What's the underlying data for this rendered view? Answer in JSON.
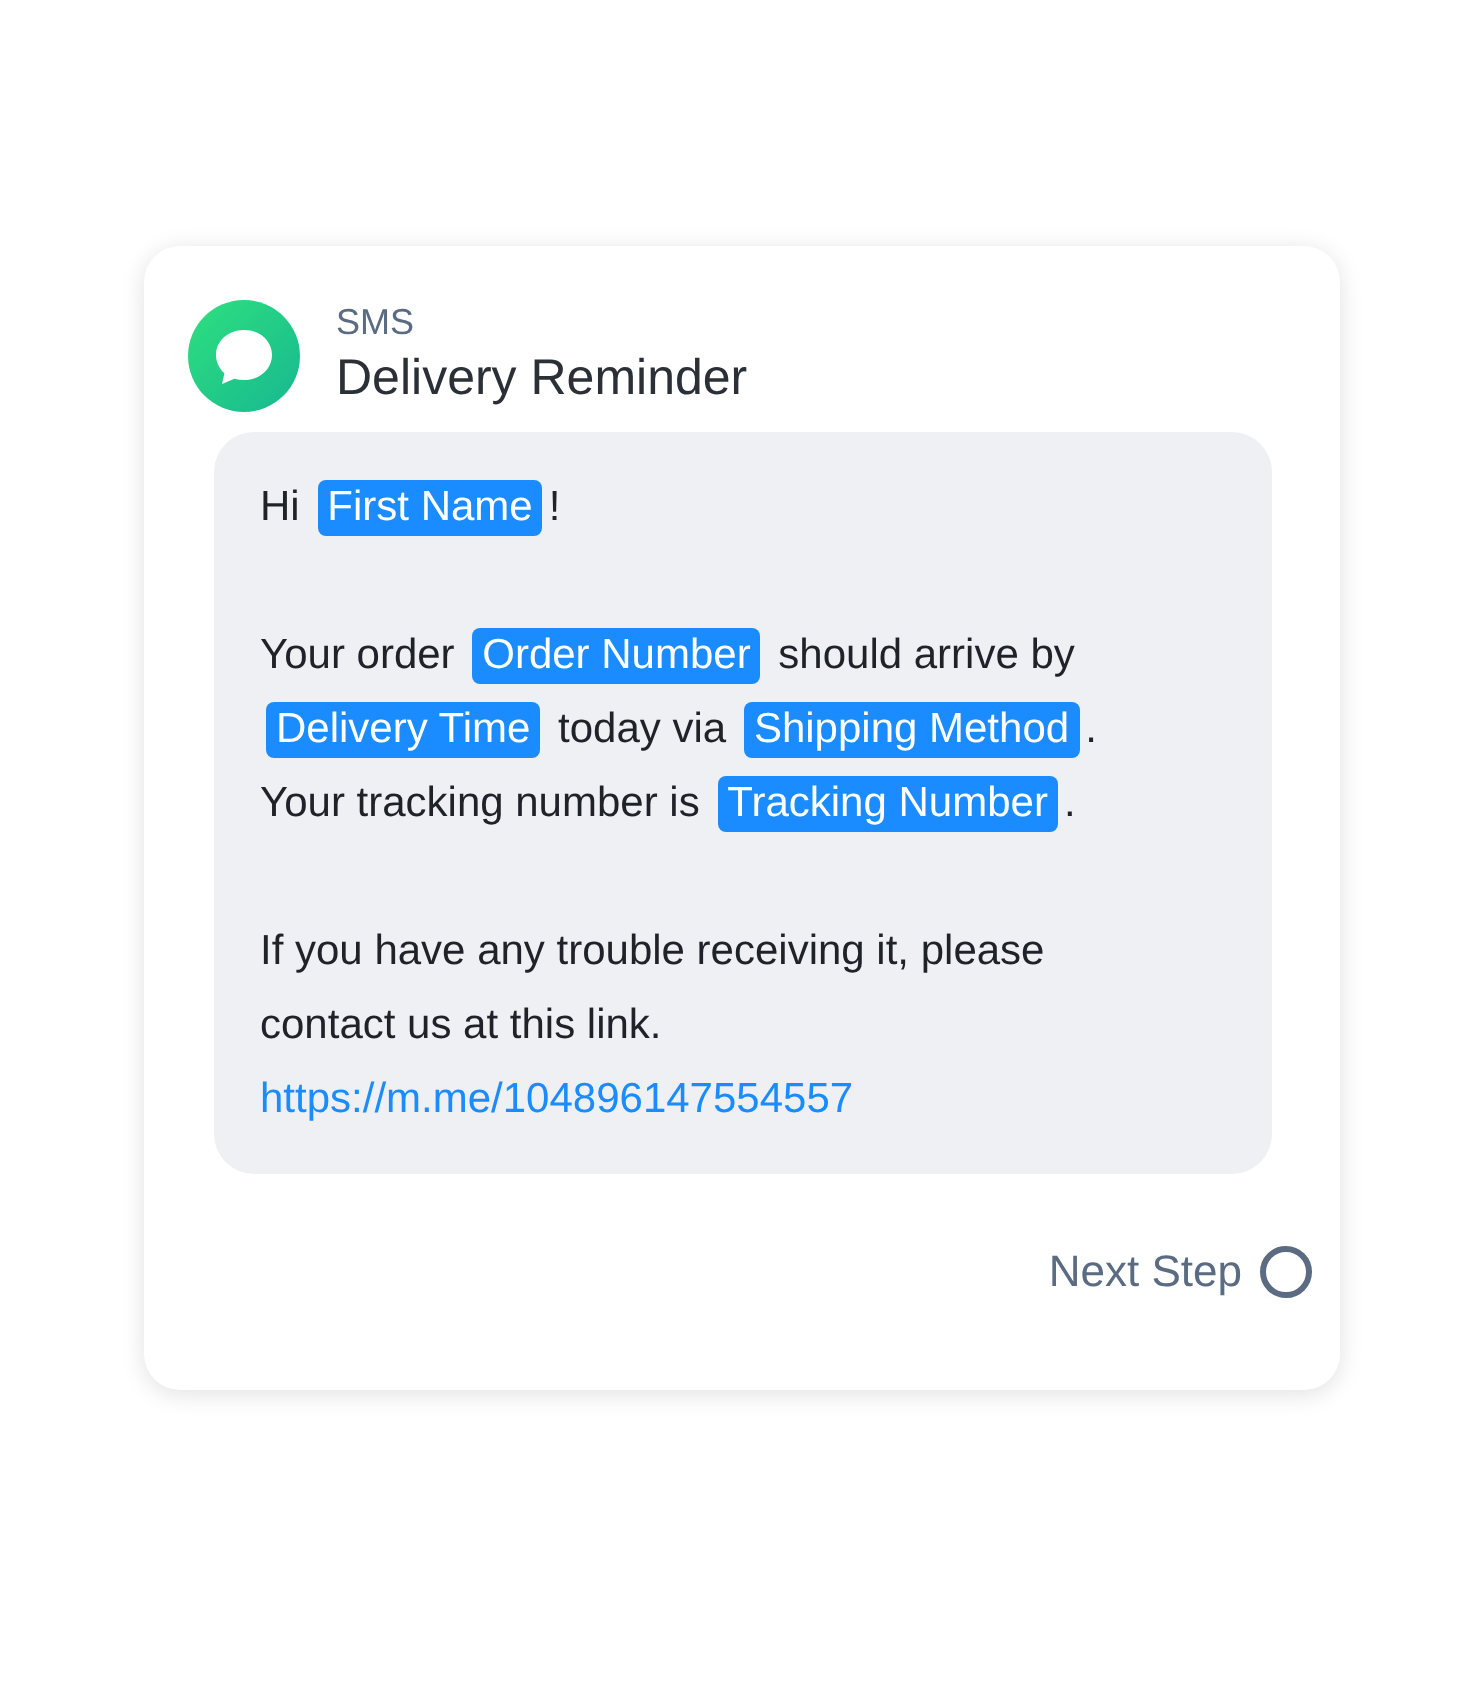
{
  "header": {
    "channel": "SMS",
    "title": "Delivery Reminder"
  },
  "message": {
    "paragraphs": [
      {
        "lines": [
          [
            {
              "kind": "text",
              "text": "Hi "
            },
            {
              "kind": "token",
              "text": "First Name"
            },
            {
              "kind": "text",
              "text": "!"
            }
          ]
        ]
      },
      {
        "lines": [
          [
            {
              "kind": "text",
              "text": "Your order "
            },
            {
              "kind": "token",
              "text": "Order Number"
            },
            {
              "kind": "text",
              "text": " should arrive by"
            }
          ],
          [
            {
              "kind": "token",
              "text": "Delivery Time"
            },
            {
              "kind": "text",
              "text": " today via "
            },
            {
              "kind": "token",
              "text": "Shipping Method"
            },
            {
              "kind": "text",
              "text": "."
            }
          ],
          [
            {
              "kind": "text",
              "text": "Your tracking number is "
            },
            {
              "kind": "token",
              "text": "Tracking Number"
            },
            {
              "kind": "text",
              "text": "."
            }
          ]
        ]
      },
      {
        "lines": [
          [
            {
              "kind": "text",
              "text": "If you have any trouble receiving it, please"
            }
          ],
          [
            {
              "kind": "text",
              "text": "contact us at this link."
            }
          ],
          [
            {
              "kind": "link",
              "text": "https://m.me/104896147554557"
            }
          ]
        ]
      }
    ]
  },
  "next_step": {
    "label": "Next Step"
  }
}
